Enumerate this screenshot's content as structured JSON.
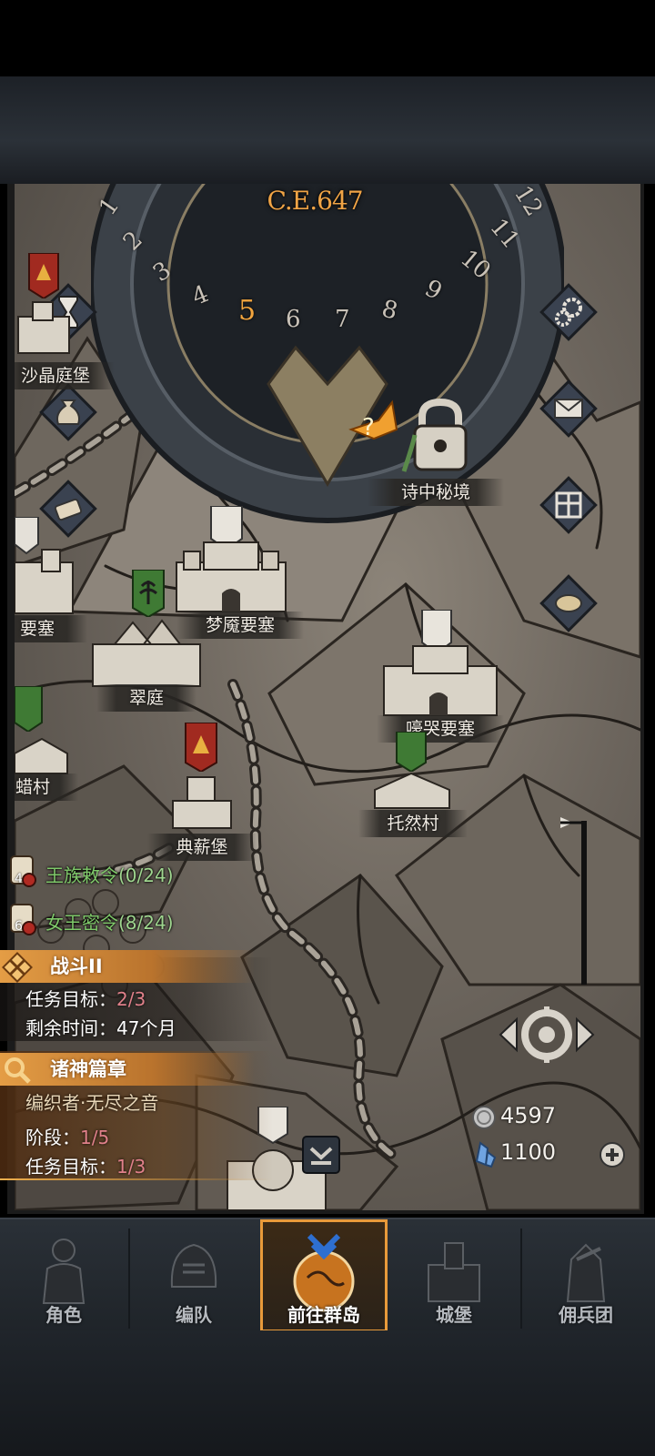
{
  "hud": {
    "era": "C.E.647",
    "months": [
      "1",
      "2",
      "3",
      "4",
      "5",
      "6",
      "7",
      "8",
      "9",
      "10",
      "11",
      "12"
    ],
    "current_month": "5"
  },
  "locations": {
    "shajing": "沙晶庭堡",
    "shizhong": "诗中秘境",
    "yaosai_left": "要塞",
    "mengyan": "梦魇要塞",
    "cuiting": "翠庭",
    "haoku": "嚎哭要塞",
    "lacun": "蜡村",
    "tuoran": "托然村",
    "dianxin": "典薪堡"
  },
  "quests": {
    "royal_decree": {
      "name": "王族敕令",
      "count": "(0/24)",
      "badge": "4"
    },
    "queen_order": {
      "name": "女王密令",
      "count": "(8/24)",
      "badge": "6"
    },
    "battle": {
      "title": "战斗II",
      "goal_label": "任务目标：",
      "goal_value": "2/3",
      "time_label": "剩余时间：",
      "time_value": "47个月"
    },
    "gods": {
      "title": "诸神篇章",
      "subtitle": "编织者·无尽之音",
      "stage_label": "阶段：",
      "stage_value": "1/5",
      "goal_label": "任务目标：",
      "goal_value": "1/3"
    }
  },
  "resources": {
    "silver": "4597",
    "crystal": "1100"
  },
  "icons": [
    "hourglass-icon",
    "coin-bag-icon",
    "scroll-icon",
    "settings-icon",
    "mail-icon",
    "grid-icon",
    "coins-icon",
    "lock-icon",
    "locate-icon",
    "collapse-icon",
    "plus-icon"
  ],
  "nav": {
    "items": [
      {
        "label": "角色"
      },
      {
        "label": "编队"
      },
      {
        "label": "前往群岛"
      },
      {
        "label": "城堡"
      },
      {
        "label": "佣兵团"
      }
    ],
    "active": "前往群岛"
  },
  "colors": {
    "accent": "#f0a446",
    "quest_green": "#7fc96a",
    "quest_value": "#e0808a",
    "background": "#000000"
  }
}
